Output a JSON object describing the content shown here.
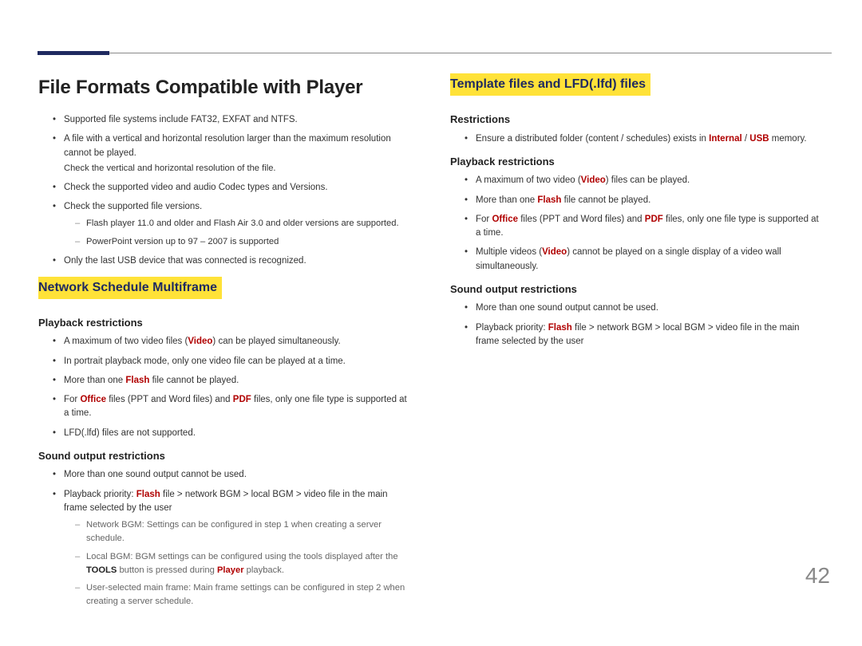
{
  "page_number": "42",
  "left": {
    "h1": "File Formats Compatible with Player",
    "intro_bullets": [
      "Supported file systems include FAT32, EXFAT and NTFS.",
      "A file with a vertical and horizontal resolution larger than the maximum resolution cannot be played.",
      "Check the supported video and audio Codec types and Versions.",
      "Check the supported file versions.",
      "Only the last USB device that was connected is recognized."
    ],
    "intro_note_after_b2": "Check the vertical and horizontal resolution of the file.",
    "intro_dashes": [
      "Flash player 11.0 and older and Flash Air 3.0 and older versions are supported.",
      "PowerPoint version up to 97 – 2007 is supported"
    ],
    "h2": "Network Schedule Multiframe",
    "sec1_h3": "Playback restrictions",
    "sec1_bullets": {
      "b0_pre": "A maximum of two video files (",
      "b0_red": "Video",
      "b0_post": ") can be played simultaneously.",
      "b1": "In portrait playback mode, only one video file can be played at a time.",
      "b2_pre": "More than one ",
      "b2_red": "Flash",
      "b2_post": " file cannot be played.",
      "b3_pre": "For ",
      "b3_red1": "Office",
      "b3_mid": " files (PPT and Word files) and ",
      "b3_red2": "PDF",
      "b3_post": " files, only one file type is supported at a time.",
      "b4": "LFD(.lfd) files are not supported."
    },
    "sec2_h3": "Sound output restrictions",
    "sec2_b0": "More than one sound output cannot be used.",
    "sec2_b1_pre": "Playback priority: ",
    "sec2_b1_red": "Flash",
    "sec2_b1_post": " file > network BGM > local BGM > video file in the main frame selected by the user",
    "sec2_dash0": "Network BGM: Settings can be configured in step 1 when creating a server schedule.",
    "sec2_dash1_pre": "Local BGM: BGM settings can be configured using the tools displayed after the ",
    "sec2_dash1_bold": "TOOLS",
    "sec2_dash1_mid": " button is pressed during ",
    "sec2_dash1_red": "Player",
    "sec2_dash1_post": " playback.",
    "sec2_dash2": "User-selected main frame: Main frame settings can be configured in step 2 when creating a server schedule."
  },
  "right": {
    "h2": "Template files and LFD(.lfd) files",
    "sec0_h3": "Restrictions",
    "sec0_b0_pre": "Ensure a distributed folder (content / schedules) exists in ",
    "sec0_b0_red1": "Internal",
    "sec0_b0_sep": " / ",
    "sec0_b0_red2": "USB",
    "sec0_b0_post": " memory.",
    "sec1_h3": "Playback restrictions",
    "sec1_b0_pre": "A maximum of two video (",
    "sec1_b0_red": "Video",
    "sec1_b0_post": ") files can be played.",
    "sec1_b1_pre": "More than one ",
    "sec1_b1_red": "Flash",
    "sec1_b1_post": " file cannot be played.",
    "sec1_b2_pre": "For ",
    "sec1_b2_red1": "Office",
    "sec1_b2_mid": " files (PPT and Word files) and ",
    "sec1_b2_red2": "PDF",
    "sec1_b2_post": " files, only one file type is supported at a time.",
    "sec1_b3_pre": "Multiple videos (",
    "sec1_b3_red": "Video",
    "sec1_b3_post": ") cannot be played on a single display of a video wall simultaneously.",
    "sec2_h3": "Sound output restrictions",
    "sec2_b0": "More than one sound output cannot be used.",
    "sec2_b1_pre": "Playback priority: ",
    "sec2_b1_red": "Flash",
    "sec2_b1_post": " file > network BGM > local BGM > video file in the main frame selected by the user"
  }
}
